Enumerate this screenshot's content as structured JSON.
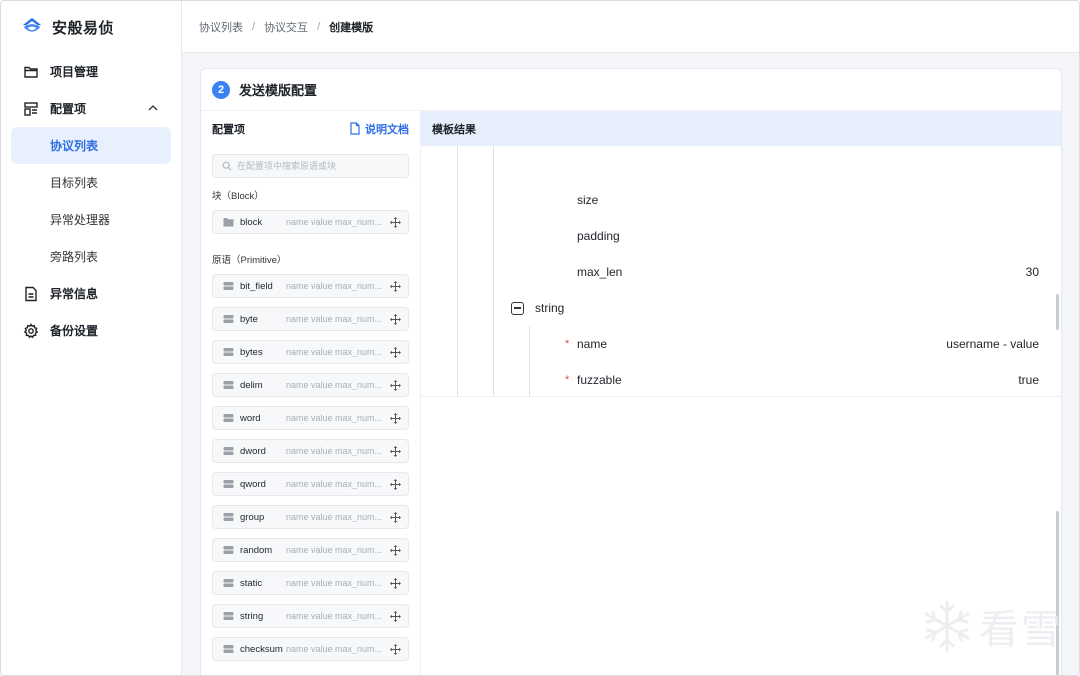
{
  "app": {
    "name": "安般易侦"
  },
  "sidebar": {
    "items": [
      {
        "label": "项目管理",
        "icon": "folder-icon"
      },
      {
        "label": "配置项",
        "icon": "layout-icon",
        "expanded": true,
        "children": [
          {
            "label": "协议列表",
            "active": true
          },
          {
            "label": "目标列表"
          },
          {
            "label": "异常处理器"
          },
          {
            "label": "旁路列表"
          }
        ]
      },
      {
        "label": "异常信息",
        "icon": "document-icon"
      },
      {
        "label": "备份设置",
        "icon": "gear-icon"
      }
    ]
  },
  "breadcrumb": [
    "协议列表",
    "协议交互",
    "创建模版"
  ],
  "breadcrumb_sep": "/",
  "card": {
    "step": "2",
    "title": "发送模版配置"
  },
  "config_panel": {
    "title": "配置项",
    "doc_link": "说明文档",
    "search_placeholder": "在配置项中搜索原语或块",
    "block_section": "块（Block）",
    "primitive_section": "原语（Primitive）",
    "hint": "name value max_num...",
    "blocks": [
      {
        "name": "block"
      }
    ],
    "primitives": [
      {
        "name": "bit_field"
      },
      {
        "name": "byte"
      },
      {
        "name": "bytes"
      },
      {
        "name": "delim"
      },
      {
        "name": "word"
      },
      {
        "name": "dword"
      },
      {
        "name": "qword"
      },
      {
        "name": "group"
      },
      {
        "name": "random"
      },
      {
        "name": "static"
      },
      {
        "name": "string"
      },
      {
        "name": "checksum"
      }
    ]
  },
  "result_panel": {
    "title": "模板结果",
    "rows": [
      {
        "key": "size",
        "value": ""
      },
      {
        "key": "padding",
        "value": ""
      },
      {
        "key": "max_len",
        "value": "30"
      },
      {
        "key": "string",
        "group": true
      },
      {
        "key": "name",
        "value": "username - value",
        "required": true
      },
      {
        "key": "fuzzable",
        "value": "true",
        "required": true
      }
    ],
    "required_mark": "*"
  },
  "watermark": {
    "text": "看雪"
  },
  "colors": {
    "accent": "#2f6fe6",
    "active_bg": "#e8f0fe",
    "result_header_bg": "#e6effb",
    "required": "#e5484d"
  }
}
